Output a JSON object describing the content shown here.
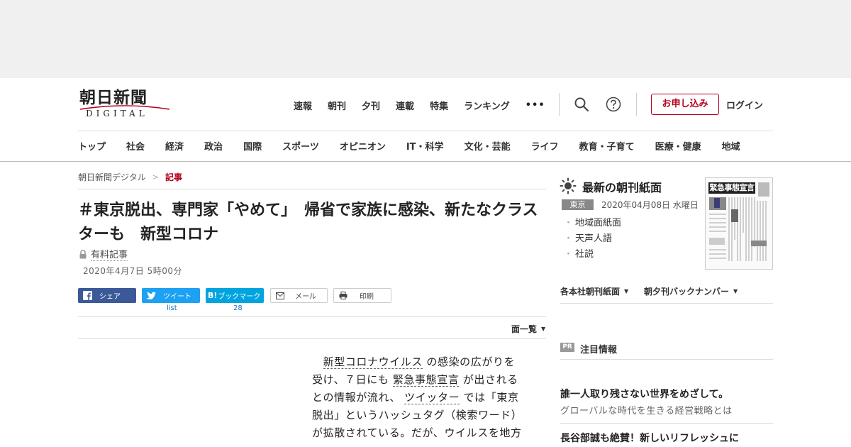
{
  "logo": {
    "main": "朝日新聞",
    "sub": "DIGITAL"
  },
  "top_nav": [
    "速報",
    "朝刊",
    "夕刊",
    "連載",
    "特集",
    "ランキング"
  ],
  "more": "•••",
  "apply_label": "お申し込み",
  "login_label": "ログイン",
  "categories": [
    "トップ",
    "社会",
    "経済",
    "政治",
    "国際",
    "スポーツ",
    "オピニオン",
    "IT・科学",
    "文化・芸能",
    "ライフ",
    "教育・子育て",
    "医療・健康",
    "地域"
  ],
  "breadcrumb": {
    "home": "朝日新聞デジタル",
    "sep": ">",
    "current": "記事"
  },
  "article": {
    "headline": "＃東京脱出、専門家「やめて」　帰省で家族に感染、新たなクラスターも　新型コロナ",
    "paid": "有料記事",
    "date": "2020年4月7日 5時00分",
    "body": [
      [
        "　",
        {
          "link": "新型コロナウイルス"
        },
        " の感染の広がりを"
      ],
      [
        "受け、７日にも ",
        {
          "link": "緊急事態宣言"
        },
        " が出される"
      ],
      [
        "との情報が流れ、 ",
        {
          "link": "ツイッター"
        },
        " では「東京"
      ],
      [
        "脱出」というハッシュタグ（検索ワード）"
      ],
      [
        "が拡散されている。だが、ウイルスを地方"
      ]
    ]
  },
  "share": {
    "facebook": "シェア",
    "twitter": "ツイート",
    "hatena": "ブックマーク",
    "hatena_badge": "B!",
    "mail": "メール",
    "print": "印刷",
    "twitter_count": "list",
    "hatena_count": "28"
  },
  "page_list": "面一覧",
  "sidebar": {
    "paper_title": "最新の朝刊紙面",
    "region": "東京",
    "paper_date": "2020年04月08日 水曜日",
    "paper_links": [
      "地域面紙面",
      "天声人語",
      "社説"
    ],
    "thumbnail_headline": "緊急事態宣言",
    "dropdown1": "各本社朝刊紙面",
    "dropdown2": "朝夕刊バックナンバー",
    "pr_badge": "PR",
    "pr_title": "注目情報",
    "pr_item1": "誰一人取り残さない世界をめざして。",
    "pr_item1_sub": "グローバルな時代を生きる経営戦略とは",
    "pr_item2": "長谷部誠も絶賛！新しいリフレッシュに"
  },
  "colors": {
    "brand": "#b5001f",
    "facebook": "#3b5998",
    "twitter": "#1da1f2",
    "hatena": "#00a4de"
  }
}
